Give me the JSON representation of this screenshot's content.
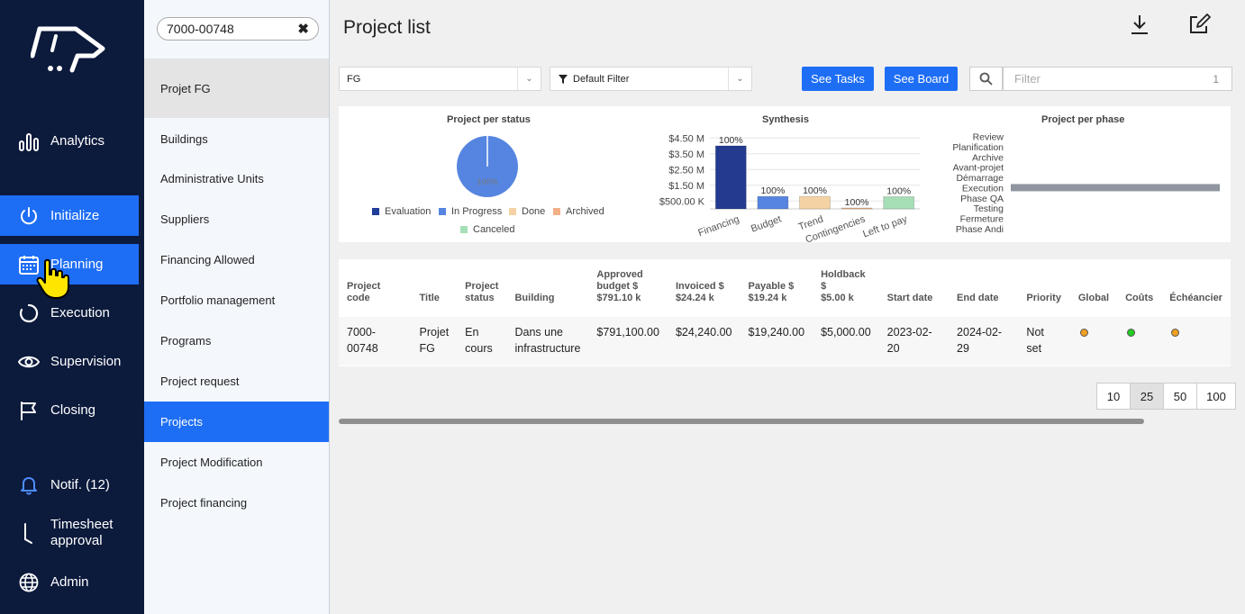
{
  "nav": {
    "items": [
      {
        "label": "Analytics",
        "icon": "bar-chart-icon"
      },
      {
        "label": "Initialize",
        "icon": "power-icon"
      },
      {
        "label": "Planning",
        "icon": "calendar-icon"
      },
      {
        "label": "Execution",
        "icon": "circle-progress-icon"
      },
      {
        "label": "Supervision",
        "icon": "eye-icon"
      },
      {
        "label": "Closing",
        "icon": "flag-icon"
      },
      {
        "label": "Notif. (12)",
        "icon": "bell-icon"
      },
      {
        "label_line1": "Timesheet",
        "label_line2": "approval",
        "icon": "clock-hand-icon"
      },
      {
        "label": "Admin",
        "icon": "globe-icon"
      }
    ]
  },
  "submenu": {
    "search_value": "7000-00748",
    "header": "Projet FG",
    "items": [
      "Buildings",
      "Administrative Units",
      "Suppliers",
      "Financing Allowed",
      "Portfolio management",
      "Programs",
      "Project request",
      "Projects",
      "Project Modification",
      "Project financing"
    ]
  },
  "main": {
    "title": "Project list",
    "project_select": "FG",
    "filter_select": "Default Filter",
    "see_tasks": "See Tasks",
    "see_board": "See Board",
    "filter_placeholder": "Filter",
    "filter_count": "1"
  },
  "chart_data": [
    {
      "type": "pie",
      "title": "Project per status",
      "slices": [
        {
          "label": "In Progress",
          "value": 100
        }
      ],
      "slice_label": "100%",
      "legend": [
        {
          "label": "Evaluation",
          "color": "#1f3d99"
        },
        {
          "label": "In Progress",
          "color": "#5585e0"
        },
        {
          "label": "Done",
          "color": "#f5d2a3"
        },
        {
          "label": "Archived",
          "color": "#f2b087"
        },
        {
          "label": "Canceled",
          "color": "#a6dfb6"
        }
      ]
    },
    {
      "type": "bar",
      "title": "Synthesis",
      "categories": [
        "Financing",
        "Budget",
        "Trend",
        "Contingencies",
        "Left to pay"
      ],
      "values": [
        4000000,
        791100,
        791100,
        20000,
        771860
      ],
      "data_labels": [
        "100%",
        "100%",
        "100%",
        "100%",
        "100%"
      ],
      "colors": [
        "#233a8f",
        "#5585e0",
        "#f5d2a3",
        "#f2b087",
        "#a6dfb6"
      ],
      "y_ticks": [
        "$4.50 M",
        "$3.50 M",
        "$2.50 M",
        "$1.50 M",
        "$500.00 K"
      ],
      "y_tick_values": [
        4500000,
        3500000,
        2500000,
        1500000,
        500000
      ],
      "ylim": [
        0,
        4800000
      ]
    },
    {
      "type": "bar",
      "orientation": "horizontal",
      "title": "Project per phase",
      "categories": [
        "Review",
        "Planification",
        "Archive",
        "Avant-projet",
        "Démarrage",
        "Execution",
        "Phase QA",
        "Testing",
        "Fermeture",
        "Phase Andi"
      ],
      "values": [
        0,
        0,
        0,
        0,
        0,
        1,
        0,
        0,
        0,
        0
      ],
      "color": "#8f969f"
    }
  ],
  "table": {
    "headers": [
      {
        "lines": [
          "Project code"
        ]
      },
      {
        "lines": [
          "Title"
        ]
      },
      {
        "lines": [
          "Project",
          "status"
        ]
      },
      {
        "lines": [
          "Building"
        ]
      },
      {
        "lines": [
          "Approved",
          "budget $",
          "$791.10 k"
        ]
      },
      {
        "lines": [
          "Invoiced $",
          "$24.24 k"
        ]
      },
      {
        "lines": [
          "Payable $",
          "$19.24 k"
        ]
      },
      {
        "lines": [
          "Holdback",
          "$",
          "$5.00 k"
        ]
      },
      {
        "lines": [
          "Start date"
        ]
      },
      {
        "lines": [
          "End date"
        ]
      },
      {
        "lines": [
          "Priority"
        ]
      },
      {
        "lines": [
          "Global"
        ]
      },
      {
        "lines": [
          "Coûts"
        ]
      },
      {
        "lines": [
          "Échéancier"
        ]
      }
    ],
    "rows": [
      {
        "code": "7000-00748",
        "title_line1": "Projet",
        "title_line2": "FG",
        "status_line1": "En",
        "status_line2": "cours",
        "building_line1": "Dans une",
        "building_line2": "infrastructure",
        "approved": "$791,100.00",
        "invoiced": "$24,240.00",
        "payable": "$19,240.00",
        "holdback": "$5,000.00",
        "start": "2023-02-20",
        "end": "2024-02-29",
        "priority": "Not set",
        "global_color": "#f0a020",
        "costs_color": "#22cc22",
        "schedule_color": "#f0a020"
      }
    ]
  },
  "pager": [
    "10",
    "25",
    "50",
    "100"
  ],
  "pager_active": "25"
}
